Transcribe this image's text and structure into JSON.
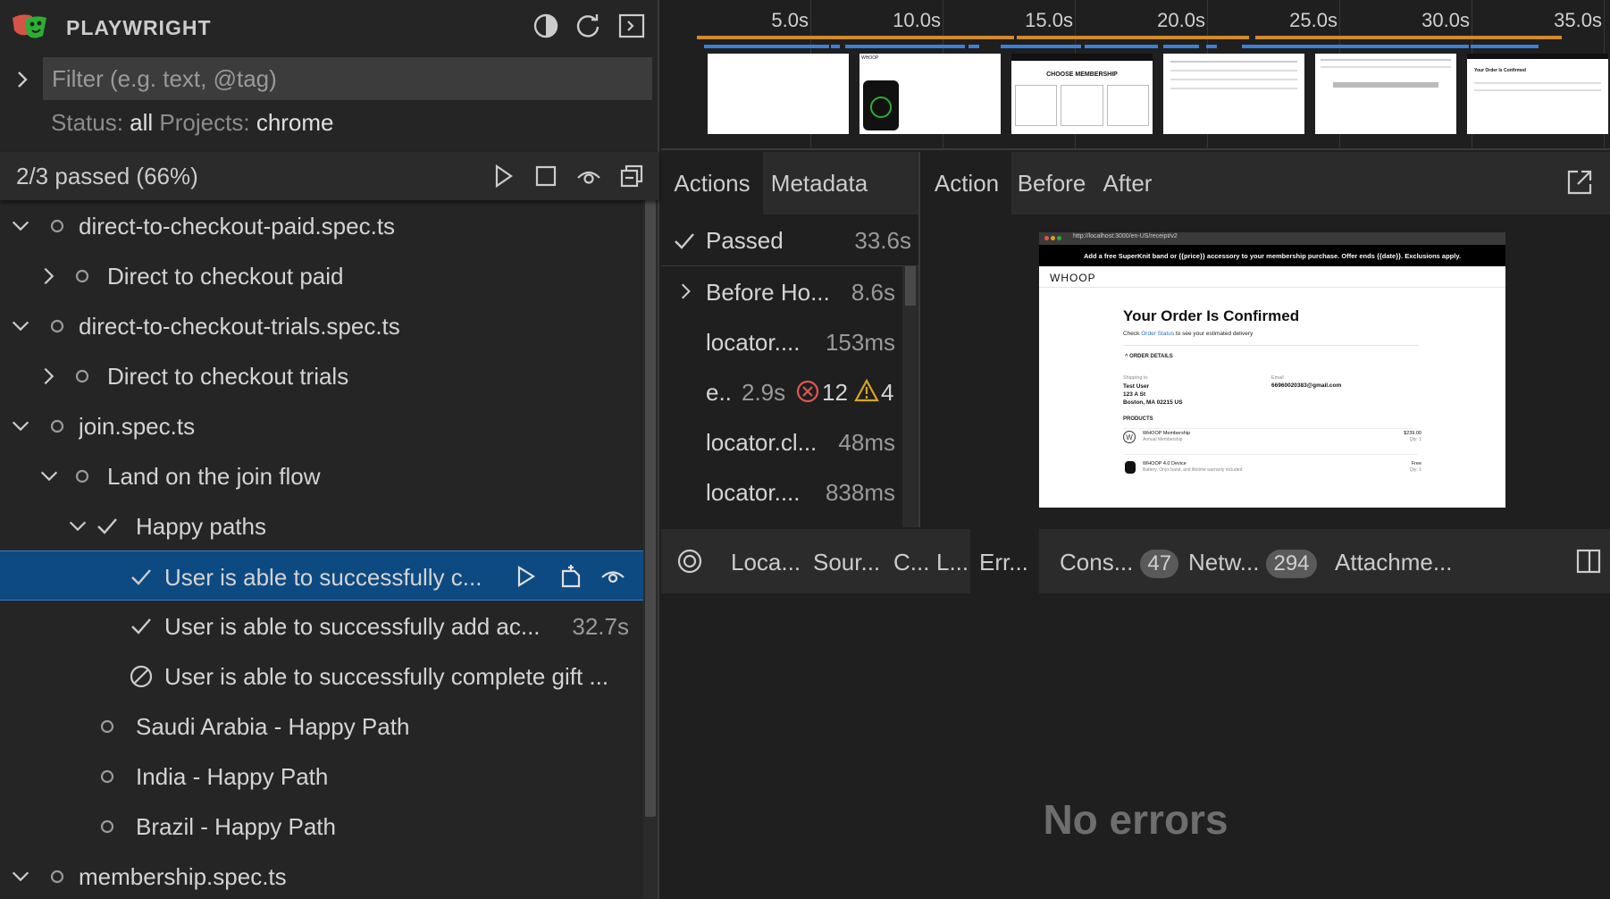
{
  "app": {
    "title": "PLAYWRIGHT"
  },
  "filter": {
    "placeholder": "Filter (e.g. text, @tag)",
    "status_label": "Status:",
    "status_value": "all",
    "projects_label": "Projects:",
    "projects_value": "chrome"
  },
  "summary": {
    "text": "2/3 passed (66%)"
  },
  "tree": [
    {
      "label": "direct-to-checkout-paid.spec.ts",
      "indent": 0,
      "twisty": "down",
      "status": "circle"
    },
    {
      "label": "Direct to checkout paid",
      "indent": 1,
      "twisty": "right",
      "status": "circle"
    },
    {
      "label": "direct-to-checkout-trials.spec.ts",
      "indent": 0,
      "twisty": "down",
      "status": "circle"
    },
    {
      "label": "Direct to checkout trials",
      "indent": 1,
      "twisty": "right",
      "status": "circle"
    },
    {
      "label": "join.spec.ts",
      "indent": 0,
      "twisty": "down",
      "status": "circle"
    },
    {
      "label": "Land on the join flow",
      "indent": 1,
      "twisty": "down",
      "status": "circle"
    },
    {
      "label": "Happy paths",
      "indent": 2,
      "twisty": "down",
      "status": "check"
    },
    {
      "label": "User is able to successfully c...",
      "indent": 3,
      "twisty": "none",
      "status": "check",
      "selected": true
    },
    {
      "label": "User is able to successfully add ac...",
      "indent": 3,
      "twisty": "none",
      "status": "check",
      "duration": "32.7s"
    },
    {
      "label": "User is able to successfully complete gift ...",
      "indent": 3,
      "twisty": "none",
      "status": "skipped"
    },
    {
      "label": "Saudi Arabia - Happy Path",
      "indent": 2,
      "twisty": "none",
      "status": "circle"
    },
    {
      "label": "India - Happy Path",
      "indent": 2,
      "twisty": "none",
      "status": "circle"
    },
    {
      "label": "Brazil - Happy Path",
      "indent": 2,
      "twisty": "none",
      "status": "circle"
    },
    {
      "label": "membership.spec.ts",
      "indent": 0,
      "twisty": "down",
      "status": "circle"
    }
  ],
  "timeline": {
    "ticks": [
      "5.0s",
      "10.0s",
      "15.0s",
      "20.0s",
      "25.0s",
      "30.0s",
      "35.0s"
    ]
  },
  "actions": {
    "tabs": [
      "Actions",
      "Metadata"
    ],
    "passed_label": "Passed",
    "passed_duration": "33.6s",
    "items": [
      {
        "title": "Before Ho...",
        "duration": "8.6s"
      },
      {
        "title": "locator....",
        "duration": "153ms"
      },
      {
        "title": "e..",
        "duration": "2.9s",
        "errors": "12",
        "warnings": "4"
      },
      {
        "title": "locator.cl...",
        "duration": "48ms"
      },
      {
        "title": "locator....",
        "duration": "838ms"
      }
    ]
  },
  "snapshot": {
    "tabs": [
      "Action",
      "Before",
      "After"
    ],
    "url": "http://localhost:3000/en-US/receipt/v2",
    "banner": "Add a free SuperKnit band or {{price}} accessory to your membership purchase. Offer ends {{date}}. Exclusions apply.",
    "brand": "WHOOP",
    "heading": "Your Order Is Confirmed",
    "check_prefix": "Check",
    "check_link": "Order Status",
    "check_suffix": "to see your estimated delivery",
    "order_details": "ORDER DETAILS",
    "shipping_label": "Shipping to",
    "shipping_name": "Test User",
    "shipping_street": "123 A St",
    "shipping_city": "Boston, MA 02215 US",
    "email_label": "Email",
    "email_value": "66960020383@gmail.com",
    "products_label": "PRODUCTS",
    "product1_name": "WHOOP Membership",
    "product1_sub": "Annual Membership",
    "product1_price": "$239.00",
    "product1_qty": "Qty: 1",
    "product2_name": "WHOOP 4.0 Device",
    "product2_sub": "Battery, Onyx band, and lifetime warranty included",
    "product2_price": "Free",
    "product2_qty": "Qty: 1"
  },
  "bottom": {
    "tabs": [
      {
        "label": "Loca..."
      },
      {
        "label": "Sour..."
      },
      {
        "label": "C..."
      },
      {
        "label": "L..."
      },
      {
        "label": "Err...",
        "active": true
      },
      {
        "label": "Cons...",
        "badge": "47"
      },
      {
        "label": "Netw...",
        "badge": "294"
      },
      {
        "label": "Attachme..."
      }
    ],
    "empty_message": "No errors"
  },
  "colors": {
    "selected_bg": "#0e4a82",
    "timeline_orange": "#d18a2b",
    "timeline_blue": "#3c7fd8",
    "error_red": "#e2574c",
    "warning_yellow": "#d7a521"
  }
}
